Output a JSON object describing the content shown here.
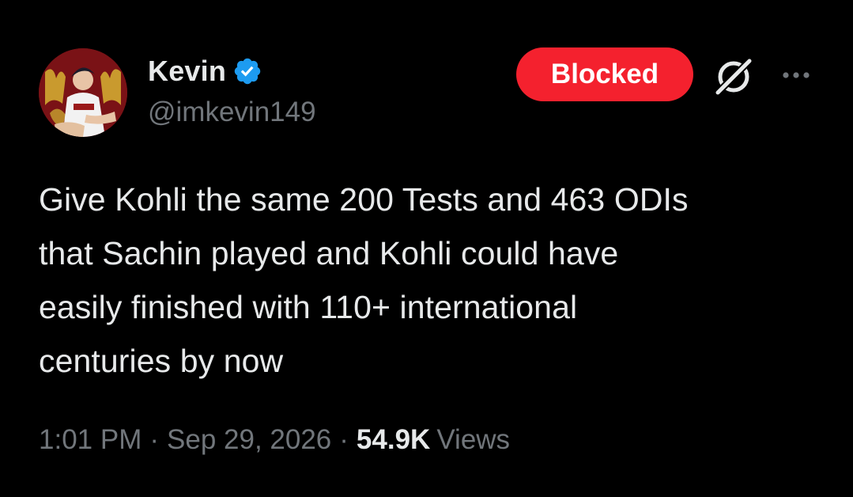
{
  "author": {
    "display_name": "Kevin",
    "handle": "@imkevin149",
    "verified": true,
    "avatar_icon": "profile-photo",
    "verified_icon": "verified-badge-icon"
  },
  "actions": {
    "blocked_label": "Blocked",
    "grok_icon": "grok-icon",
    "more_icon": "more-options-icon"
  },
  "tweet": {
    "text": "Give Kohli the same 200 Tests and 463 ODIs\nthat Sachin played and Kohli could have\neasily finished with 110+ international\ncenturies by now"
  },
  "meta": {
    "time": "1:01 PM",
    "separator": "·",
    "date": "Sep 29, 2026",
    "views_count": "54.9K",
    "views_label": "Views"
  },
  "colors": {
    "background": "#000000",
    "primary_text": "#e7e9ea",
    "secondary_text": "#71767b",
    "blocked_red": "#f4212e",
    "verified_blue": "#1d9bf0"
  }
}
